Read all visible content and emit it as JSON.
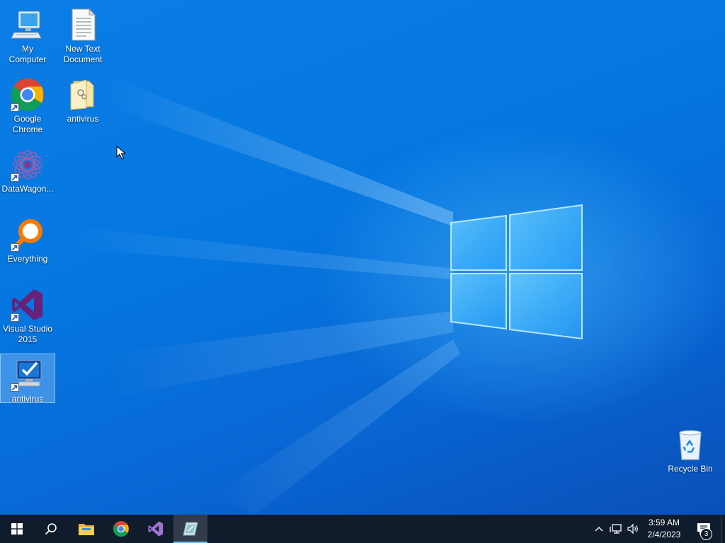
{
  "desktop": {
    "icons": [
      {
        "label": "My Computer",
        "icon": "computer-icon"
      },
      {
        "label": "New Text Document",
        "icon": "text-document-icon"
      },
      {
        "label": "Google Chrome",
        "icon": "chrome-icon",
        "shortcut": true
      },
      {
        "label": "antivirus",
        "icon": "folder-icon"
      },
      {
        "label": "DataWagon...",
        "icon": "datawagon-icon",
        "shortcut": true
      },
      {
        "label": "Everything",
        "icon": "everything-search-icon",
        "shortcut": true
      },
      {
        "label": "Visual Studio 2015",
        "icon": "visual-studio-icon",
        "shortcut": true
      },
      {
        "label": "antivirus",
        "icon": "antivirus-app-icon",
        "shortcut": true,
        "selected": true
      },
      {
        "label": "Recycle Bin",
        "icon": "recycle-bin-icon"
      }
    ]
  },
  "taskbar": {
    "buttons": [
      {
        "name": "start",
        "icon": "windows-start-icon"
      },
      {
        "name": "search",
        "icon": "search-icon"
      },
      {
        "name": "file-explorer",
        "icon": "folder-icon"
      },
      {
        "name": "chrome",
        "icon": "chrome-icon"
      },
      {
        "name": "visual-studio",
        "icon": "visual-studio-icon"
      },
      {
        "name": "antivirus",
        "icon": "antivirus-app-icon",
        "active": true
      }
    ],
    "tray": {
      "icons": [
        "chevron-up-icon",
        "network-icon",
        "volume-icon"
      ],
      "time": "3:59 AM",
      "date": "2/4/2023",
      "notification_count": "3"
    }
  },
  "colors": {
    "wallpaper": "#0577e0",
    "taskbar": "#101c2b",
    "selection": "#aad2ff",
    "active_indicator": "#76b9ed"
  }
}
